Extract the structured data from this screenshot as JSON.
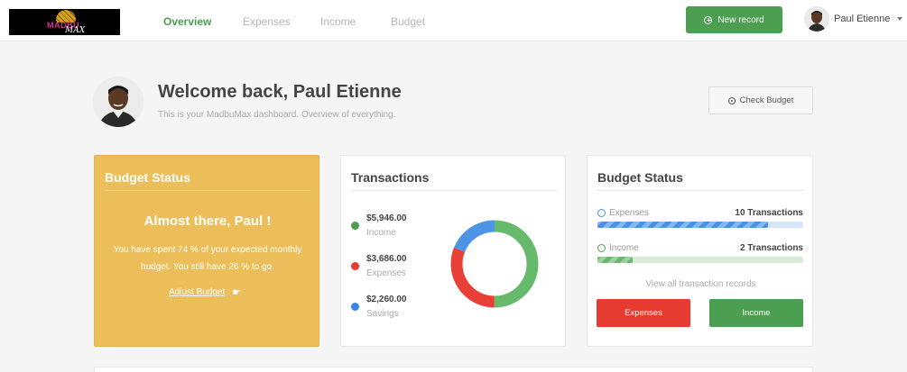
{
  "brand": {
    "logo_line1": "MADBU",
    "logo_line2": "MAX"
  },
  "nav": {
    "tabs": [
      {
        "label": "Overview",
        "active": true
      },
      {
        "label": "Expenses",
        "active": false
      },
      {
        "label": "Income",
        "active": false
      },
      {
        "label": "Budget",
        "active": false
      }
    ],
    "new_record_label": "New record",
    "user_name": "Paul Etienne"
  },
  "welcome": {
    "title": "Welcome back, Paul Etienne",
    "subtitle": "This is your MadbuMax dashboard. Overview of everything.",
    "check_budget_label": "Check Budget"
  },
  "budget_status_card": {
    "title": "Budget Status",
    "headline": "Almost there, Paul !",
    "body": "You have spent 74 % of your expected monthly budget. You still have 26 % to go.",
    "link_label": "Adjust Budget",
    "spent_percent": 74,
    "remaining_percent": 26
  },
  "transactions_card": {
    "title": "Transactions",
    "items": [
      {
        "amount": "$5,946.00",
        "label": "Income",
        "value": 5946,
        "color": "#67b96b"
      },
      {
        "amount": "$3,686.00",
        "label": "Expenses",
        "value": 3686,
        "color": "#e84036"
      },
      {
        "amount": "$2,260.00",
        "label": "Savings",
        "value": 2260,
        "color": "#4d94e6"
      }
    ]
  },
  "budget_card": {
    "title": "Budget Status",
    "rows": [
      {
        "label": "Expenses",
        "count": "10 Transactions",
        "fill_fraction": 0.83,
        "color": "#4d8fe0",
        "track": "#d6e6f8",
        "striped": true
      },
      {
        "label": "Income",
        "count": "2 Transactions",
        "fill_fraction": 0.17,
        "color": "#67b96b",
        "track": "#d6ecd7",
        "striped": true
      }
    ],
    "view_all_label": "View all transaction records",
    "expenses_button": "Expenses",
    "income_button": "Income"
  },
  "colors": {
    "accent_green": "#4c9e50",
    "accent_red": "#e53b30",
    "yellow_card": "#ecbe5a"
  }
}
